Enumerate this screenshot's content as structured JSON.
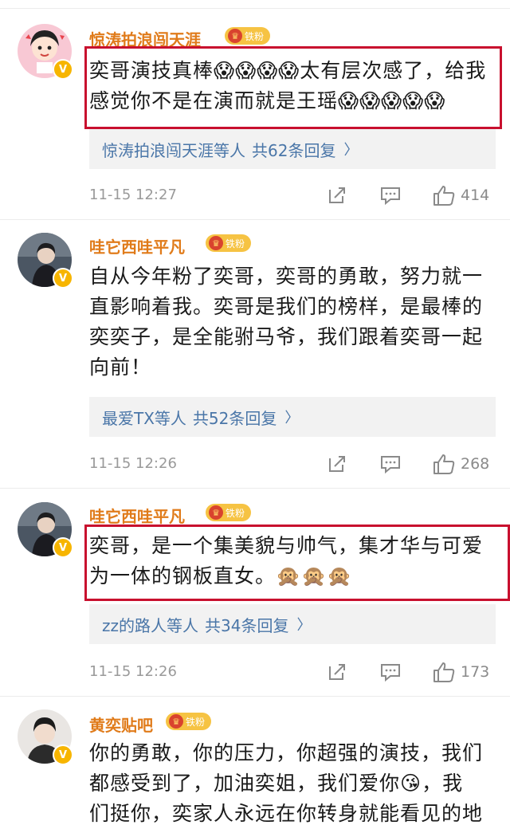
{
  "comments": [
    {
      "username": "惊涛拍浪闯天涯",
      "badge": "铁粉",
      "text_lines": [
        "奕哥演技真棒😱😱😱😱太有层次感了，给我",
        "感觉你不是在演而就是王瑶😱😱😱😱😱"
      ],
      "reply_who": "惊涛拍浪闯天涯等人",
      "reply_count": "共62条回复",
      "time": "11-15 12:27",
      "likes": "414"
    },
    {
      "username": "哇它西哇平凡",
      "badge": "铁粉",
      "text_lines": [
        "自从今年粉了奕哥，奕哥的勇敢，努力就一",
        "直影响着我。奕哥是我们的榜样，是最棒的",
        "奕奕子，是全能驸马爷，我们跟着奕哥一起",
        "向前！"
      ],
      "reply_who": "最爱TX等人",
      "reply_count": "共52条回复",
      "time": "11-15 12:26",
      "likes": "268"
    },
    {
      "username": "哇它西哇平凡",
      "badge": "铁粉",
      "text_lines": [
        "奕哥，是一个集美貌与帅气，集才华与可爱",
        "为一体的钢板直女。🙊🙊🙊"
      ],
      "reply_who": "zz的路人等人",
      "reply_count": "共34条回复",
      "time": "11-15 12:26",
      "likes": "173"
    },
    {
      "username": "黄奕贴吧",
      "badge": "铁粉",
      "text_lines": [
        "你的勇敢，你的压力，你超强的演技，我们",
        "都感受到了，加油奕姐，我们爱你😘，我",
        "们挺你，奕家人永远在你转身就能看见的地"
      ]
    }
  ],
  "icons": {
    "verified": "V",
    "crown": "♛",
    "chevron": "〉"
  },
  "colors": {
    "username": "#e07b1a",
    "reply_link": "#4a76a8",
    "highlight": "#c8102e",
    "badge": "#f6c343"
  }
}
